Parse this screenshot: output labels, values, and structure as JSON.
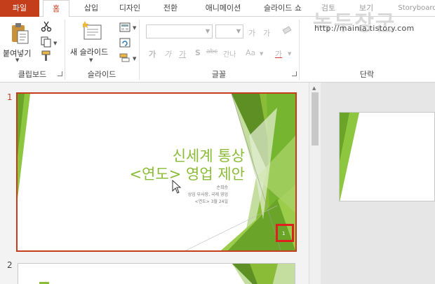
{
  "tabs": {
    "file": "파일",
    "home": "홈",
    "insert": "삽입",
    "design": "디자인",
    "transitions": "전환",
    "animations": "애니메이션",
    "slideshow": "슬라이드 쇼",
    "review": "검토",
    "view": "보기",
    "storyboard": "Storyboard"
  },
  "ribbon": {
    "clipboard": {
      "paste_label": "붙여넣기",
      "group_label": "클립보드"
    },
    "slides": {
      "new_slide_label": "새 슬라이드",
      "group_label": "슬라이드"
    },
    "font": {
      "group_label": "글꼴",
      "row1": [
        "가",
        "가"
      ],
      "row2": [
        "가",
        "가",
        "가",
        "S",
        "abc",
        "간나",
        "Aa",
        "가"
      ]
    },
    "paragraph": {
      "group_label": "단락"
    }
  },
  "watermark": {
    "title": "녹두장군",
    "url": "http://mainia.tistory.com"
  },
  "thumbnails": {
    "slide1": {
      "number": "1",
      "title_line1": "신세계 통상",
      "title_line2": "<연도> 영업 제안",
      "presenter": "손희승",
      "role": "상임 부사장, 국제 영업",
      "date": "<연도> 3월 24일",
      "slide_number": "1"
    },
    "slide2": {
      "number": "2"
    }
  },
  "colors": {
    "accent": "#c43e1c",
    "green": "#8bbc38",
    "highlight": "#e01f1f"
  }
}
